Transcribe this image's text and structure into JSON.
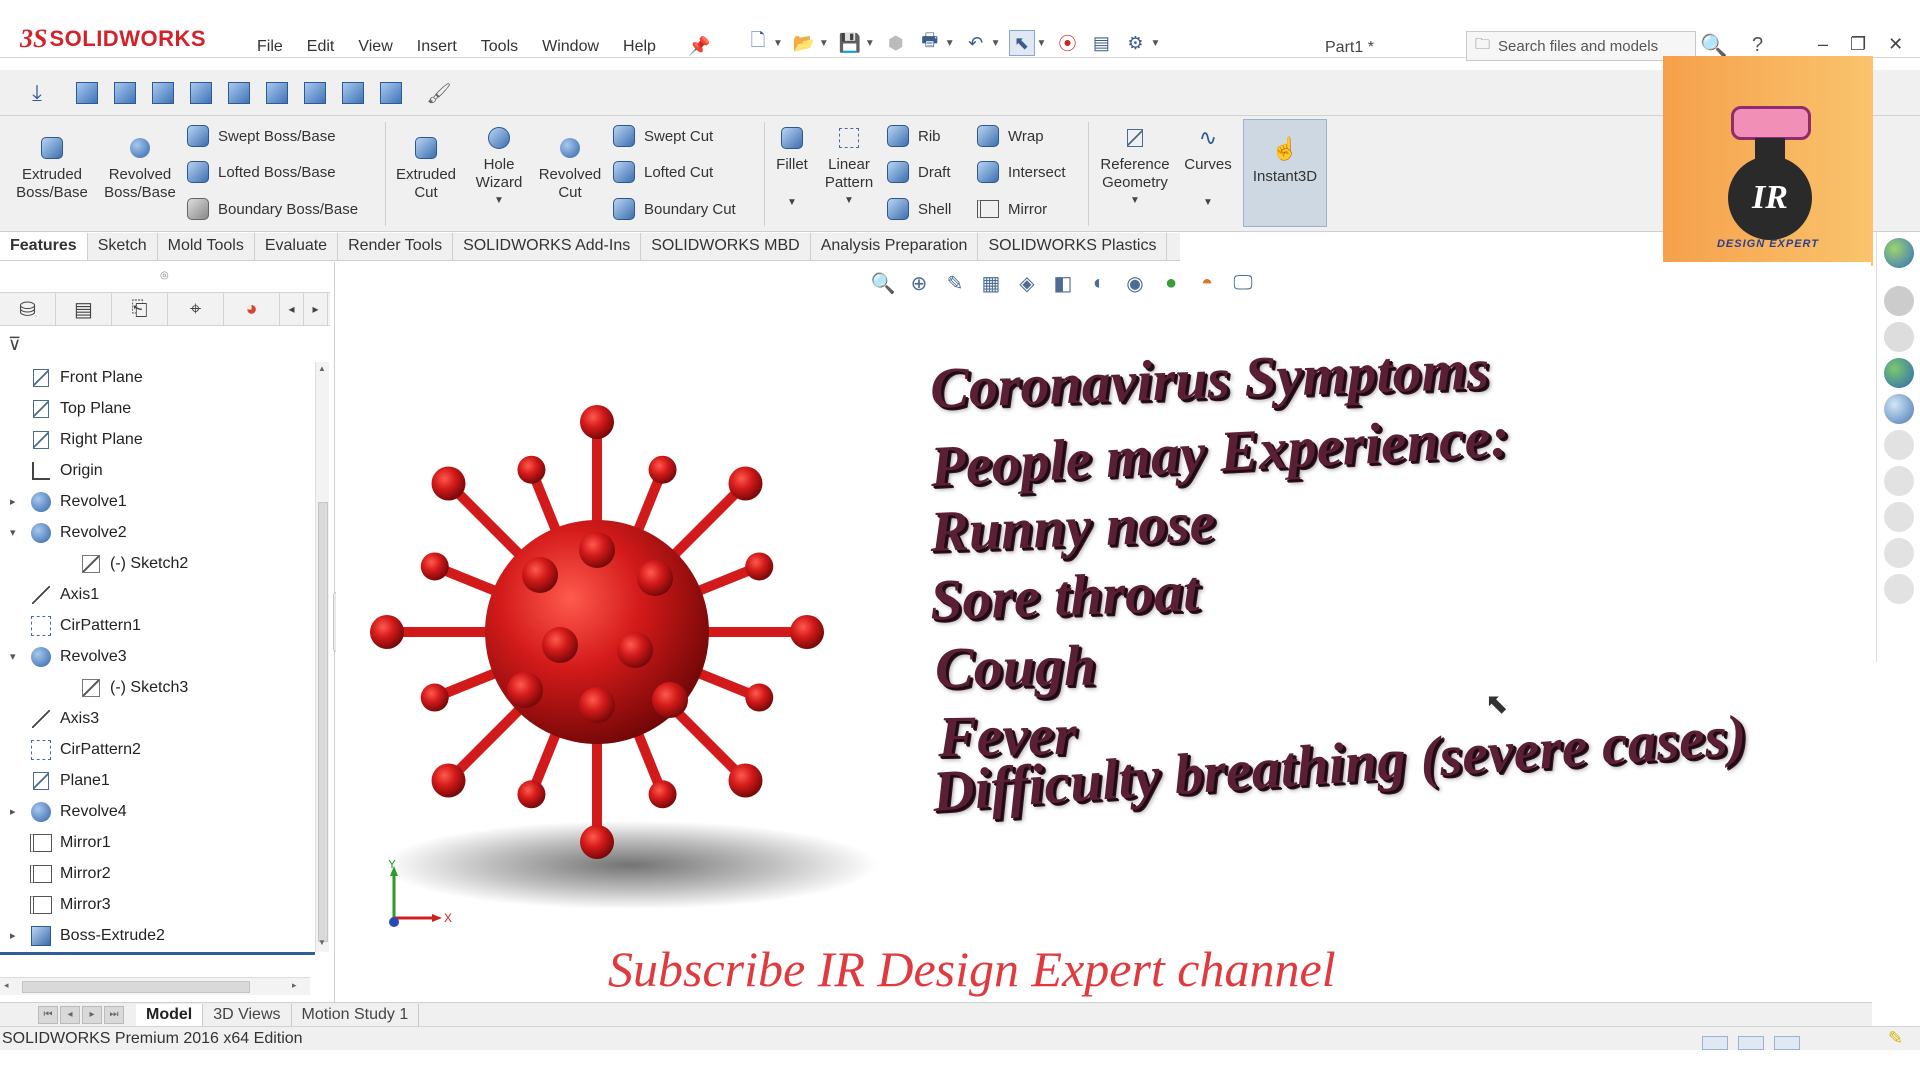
{
  "app": {
    "brand_prefix": "3S",
    "brand_name": "SOLIDWORKS",
    "document_title": "Part1 *",
    "status_text": "SOLIDWORKS Premium 2016 x64 Edition"
  },
  "menu": [
    "File",
    "Edit",
    "View",
    "Insert",
    "Tools",
    "Window",
    "Help"
  ],
  "search": {
    "placeholder": "Search files and models"
  },
  "help_label": "?",
  "window_controls": [
    "–",
    "❐",
    "✕"
  ],
  "ribbon": {
    "extruded_boss": "Extruded Boss/Base",
    "revolved_boss": "Revolved Boss/Base",
    "swept_boss": "Swept Boss/Base",
    "lofted_boss": "Lofted Boss/Base",
    "boundary_boss": "Boundary Boss/Base",
    "extruded_cut": "Extruded Cut",
    "hole_wizard": "Hole Wizard",
    "revolved_cut": "Revolved Cut",
    "swept_cut": "Swept Cut",
    "lofted_cut": "Lofted Cut",
    "boundary_cut": "Boundary Cut",
    "fillet": "Fillet",
    "linear_pattern": "Linear Pattern",
    "rib": "Rib",
    "draft": "Draft",
    "shell": "Shell",
    "wrap": "Wrap",
    "intersect": "Intersect",
    "mirror": "Mirror",
    "reference_geometry": "Reference Geometry",
    "curves": "Curves",
    "instant3d": "Instant3D"
  },
  "tabs": [
    "Features",
    "Sketch",
    "Mold Tools",
    "Evaluate",
    "Render Tools",
    "SOLIDWORKS Add-Ins",
    "SOLIDWORKS MBD",
    "Analysis Preparation",
    "SOLIDWORKS Plastics"
  ],
  "badge": {
    "monogram": "IR",
    "caption": "DESIGN EXPERT",
    "colors": {
      "bg_left": "#f6a04b",
      "bg_right": "#f9c46d",
      "text": "#2b3f8f"
    }
  },
  "feature_tree": [
    {
      "label": "Front Plane",
      "icon": "plane-icon",
      "expand": "",
      "indent": false
    },
    {
      "label": "Top Plane",
      "icon": "plane-icon",
      "expand": "",
      "indent": false
    },
    {
      "label": "Right Plane",
      "icon": "plane-icon",
      "expand": "",
      "indent": false
    },
    {
      "label": "Origin",
      "icon": "origin-icon",
      "expand": "",
      "indent": false
    },
    {
      "label": "Revolve1",
      "icon": "revolve-icon",
      "expand": "▸",
      "indent": false
    },
    {
      "label": "Revolve2",
      "icon": "revolve-icon",
      "expand": "▾",
      "indent": false
    },
    {
      "label": "(-) Sketch2",
      "icon": "sketch-icon",
      "expand": "",
      "indent": true
    },
    {
      "label": "Axis1",
      "icon": "axis-icon",
      "expand": "",
      "indent": false
    },
    {
      "label": "CirPattern1",
      "icon": "pattern-icon",
      "expand": "",
      "indent": false
    },
    {
      "label": "Revolve3",
      "icon": "revolve-icon",
      "expand": "▾",
      "indent": false
    },
    {
      "label": "(-) Sketch3",
      "icon": "sketch-icon",
      "expand": "",
      "indent": true
    },
    {
      "label": "Axis3",
      "icon": "axis-icon",
      "expand": "",
      "indent": false
    },
    {
      "label": "CirPattern2",
      "icon": "pattern-icon",
      "expand": "",
      "indent": false
    },
    {
      "label": "Plane1",
      "icon": "plane-icon",
      "expand": "",
      "indent": false
    },
    {
      "label": "Revolve4",
      "icon": "revolve-icon",
      "expand": "▸",
      "indent": false
    },
    {
      "label": "Mirror1",
      "icon": "mirror-icon",
      "expand": "",
      "indent": false
    },
    {
      "label": "Mirror2",
      "icon": "mirror-icon",
      "expand": "",
      "indent": false
    },
    {
      "label": "Mirror3",
      "icon": "mirror-icon",
      "expand": "",
      "indent": false
    },
    {
      "label": "Boss-Extrude2",
      "icon": "boss-extrude-icon",
      "expand": "▸",
      "indent": false
    }
  ],
  "viewport_text": {
    "lines": [
      "Coronavirus Symptoms",
      "People may Experience:",
      "Runny nose",
      "Sore throat",
      "Cough",
      "Fever",
      "Difficulty breathing (severe cases)"
    ],
    "subscribe": "Subscribe IR Design Expert channel",
    "axis_x": "X",
    "axis_y": "Y"
  },
  "colors": {
    "virus_red": "#d31a1a",
    "text_dark": "#5a1f34",
    "subscribe_red": "#e03a3e",
    "brand_red": "#d2232a"
  },
  "bottom_tabs": [
    "Model",
    "3D Views",
    "Motion Study 1"
  ]
}
